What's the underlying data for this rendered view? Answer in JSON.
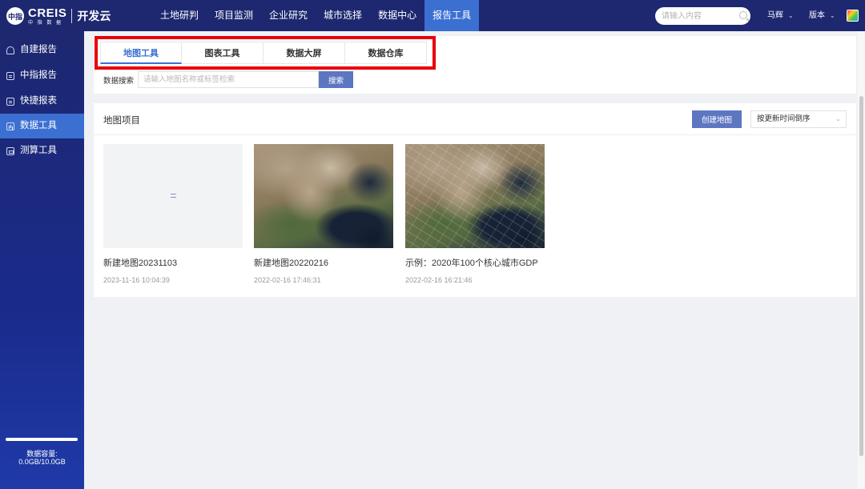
{
  "header": {
    "logo_mark": "中指",
    "brand": "CREIS",
    "brand_sub": "中 指 数 据",
    "product": "开发云",
    "nav": [
      {
        "label": "土地研判"
      },
      {
        "label": "项目监测"
      },
      {
        "label": "企业研究"
      },
      {
        "label": "城市选择"
      },
      {
        "label": "数据中心"
      },
      {
        "label": "报告工具",
        "active": true
      }
    ],
    "search_placeholder": "请输入内容",
    "user_name": "马辉",
    "version_label": "版本"
  },
  "sidebar": {
    "items": [
      {
        "label": "自建报告",
        "icon": "cloud-icon"
      },
      {
        "label": "中指报告",
        "icon": "document-icon"
      },
      {
        "label": "快捷报表",
        "icon": "document-icon"
      },
      {
        "label": "数据工具",
        "icon": "chart-icon",
        "active": true
      },
      {
        "label": "测算工具",
        "icon": "calculator-icon"
      }
    ],
    "storage_label": "数据容量:",
    "storage_value": "0.0GB/10.0GB",
    "storage_fraction": 0.0
  },
  "tabs": [
    {
      "label": "地图工具",
      "active": true
    },
    {
      "label": "图表工具"
    },
    {
      "label": "数据大屏"
    },
    {
      "label": "数据仓库"
    }
  ],
  "search": {
    "label": "数据搜索",
    "placeholder": "请输入地图名称或标签检索",
    "button": "搜索"
  },
  "projects": {
    "title": "地图项目",
    "create_button": "创建地图",
    "sort_value": "按更新时间倒序",
    "items": [
      {
        "name": "新建地图20231103",
        "time": "2023-11-16 10:04:39",
        "thumb": "blank"
      },
      {
        "name": "新建地图20220216",
        "time": "2022-02-16 17:46:31",
        "thumb": "satellite"
      },
      {
        "name": "示例：2020年100个核心城市GDP",
        "time": "2022-02-16 16:21:46",
        "thumb": "satellite-grid"
      }
    ]
  },
  "colors": {
    "header_bg": "#1d2870",
    "accent": "#3b6fd2",
    "button": "#5d76c2",
    "highlight": "#e8000b"
  }
}
